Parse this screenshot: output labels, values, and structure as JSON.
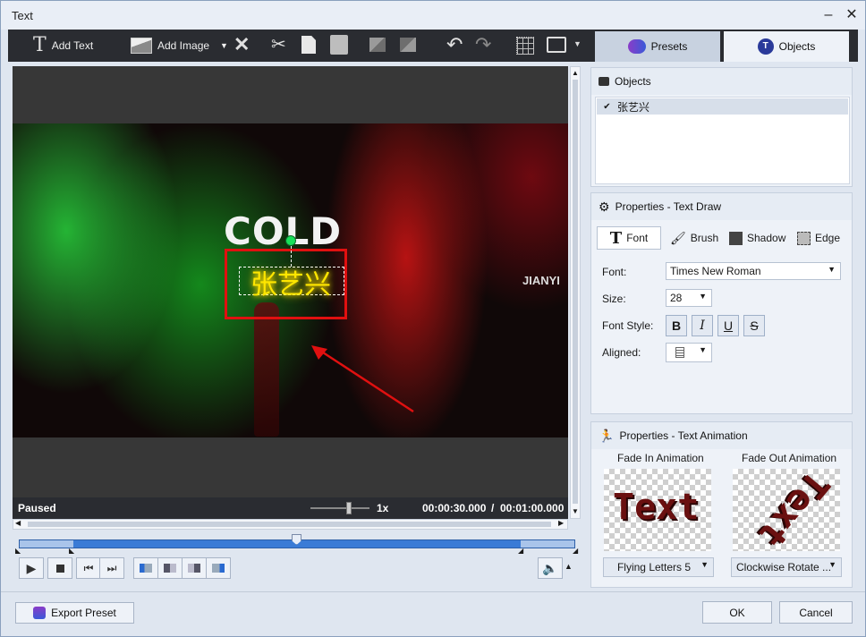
{
  "window": {
    "title": "Text",
    "minimize_glyph": "–",
    "close_glyph": "✕"
  },
  "toolbar": {
    "add_text_label": "Add Text",
    "add_image_label": "Add Image",
    "icons": [
      "text-icon",
      "image-icon",
      "dropdown-icon",
      "delete-icon",
      "cut-icon",
      "copy-icon",
      "paste-icon",
      "bring-forward-icon",
      "send-backward-icon",
      "undo-icon",
      "redo-icon",
      "grid-icon",
      "monitor-icon"
    ]
  },
  "tabs": [
    {
      "label": "Presets",
      "icon": "presets-icon",
      "active": false
    },
    {
      "label": "Objects",
      "icon": "objects-icon",
      "active": true
    }
  ],
  "preview": {
    "logo_text": "COLD",
    "corner_text": "JIANYI",
    "overlay_text": "张艺兴",
    "overlay_color": "#ffe600",
    "highlight_color": "#e01010"
  },
  "status": {
    "state": "Paused",
    "speed": "1x",
    "current_time": "00:00:30.000",
    "separator": "/",
    "total_time": "00:01:00.000"
  },
  "playback": {
    "volume_up_glyph": "▲"
  },
  "objects_panel": {
    "title": "Objects",
    "items": [
      {
        "label": "张艺兴",
        "checked": true
      }
    ]
  },
  "text_draw_panel": {
    "title": "Properties - Text Draw",
    "subtabs": [
      {
        "label": "Font",
        "icon": "font-icon"
      },
      {
        "label": "Brush",
        "icon": "brush-icon"
      },
      {
        "label": "Shadow",
        "icon": "shadow-icon"
      },
      {
        "label": "Edge",
        "icon": "edge-icon"
      }
    ],
    "font_label": "Font:",
    "font_value": "Times New Roman",
    "size_label": "Size:",
    "size_value": "28",
    "style_label": "Font Style:",
    "style_buttons": [
      "B",
      "I",
      "U",
      "S"
    ],
    "aligned_label": "Aligned:"
  },
  "animation_panel": {
    "title": "Properties - Text Animation",
    "fade_in_label": "Fade In Animation",
    "fade_out_label": "Fade Out Animation",
    "fade_in_preview_text": "Text",
    "fade_out_preview_text": "Text",
    "fade_in_value": "Flying Letters 5",
    "fade_out_value": "Clockwise Rotate ..."
  },
  "footer": {
    "export_label": "Export Preset",
    "ok_label": "OK",
    "cancel_label": "Cancel"
  }
}
